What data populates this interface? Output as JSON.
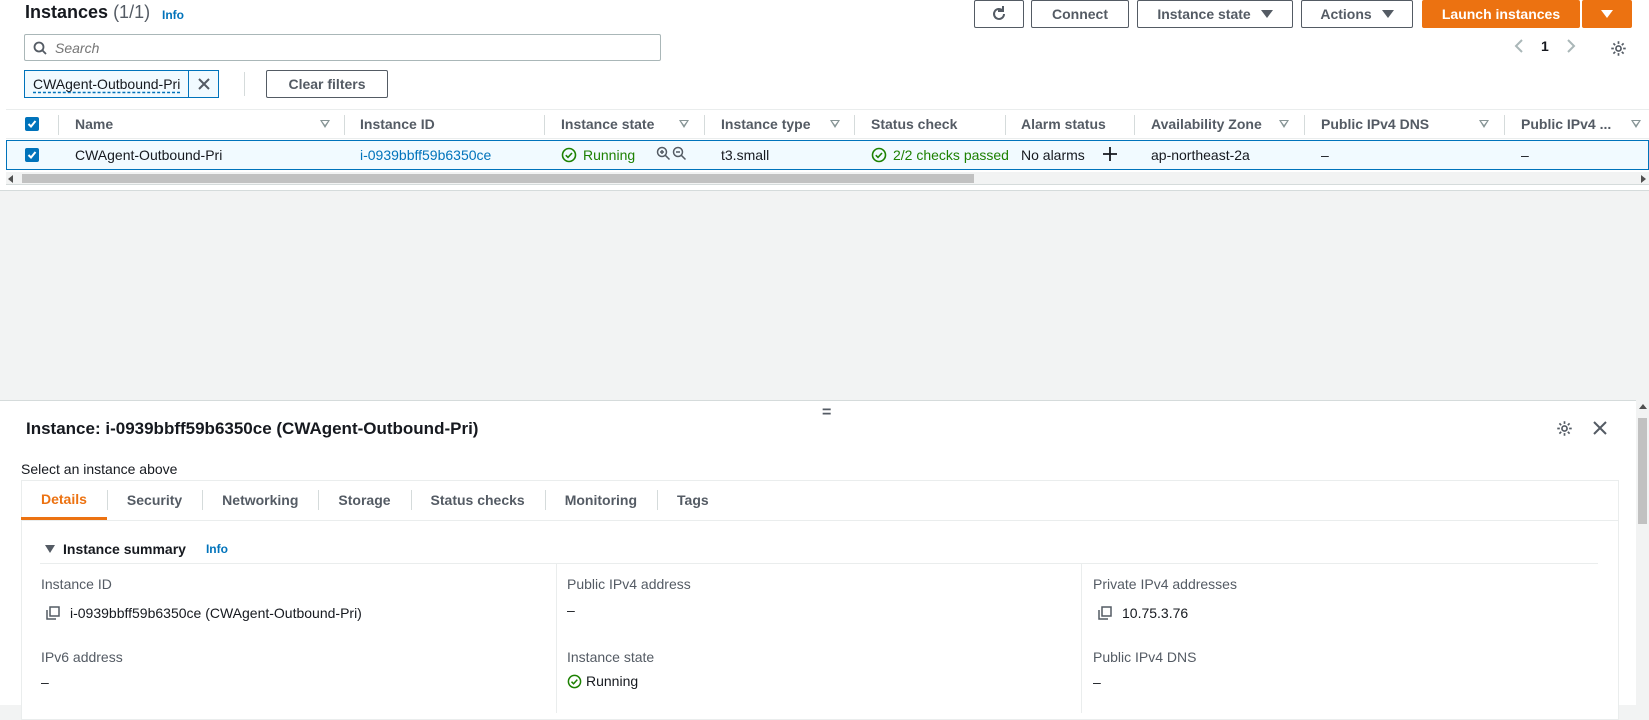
{
  "header": {
    "title": "Instances",
    "count": "(1/1)",
    "info": "Info"
  },
  "toolbar": {
    "connect": "Connect",
    "instance_state": "Instance state",
    "actions": "Actions",
    "launch": "Launch instances"
  },
  "search": {
    "placeholder": "Search"
  },
  "pagination": {
    "page": "1"
  },
  "filter": {
    "chip": "CWAgent-Outbound-Pri",
    "clear": "Clear filters"
  },
  "table": {
    "columns": [
      "Name",
      "Instance ID",
      "Instance state",
      "Instance type",
      "Status check",
      "Alarm status",
      "Availability Zone",
      "Public IPv4 DNS",
      "Public IPv4 ..."
    ],
    "row": {
      "name": "CWAgent-Outbound-Pri",
      "instance_id": "i-0939bbff59b6350ce",
      "state": "Running",
      "type": "t3.small",
      "status_check": "2/2 checks passed",
      "alarm": "No alarms",
      "az": "ap-northeast-2a",
      "public_dns": "–",
      "public_ipv4": "–"
    }
  },
  "detail": {
    "title": "Instance: i-0939bbff59b6350ce (CWAgent-Outbound-Pri)",
    "hint": "Select an instance above",
    "tabs": [
      "Details",
      "Security",
      "Networking",
      "Storage",
      "Status checks",
      "Monitoring",
      "Tags"
    ],
    "active_tab": "Details",
    "summary_title": "Instance summary",
    "summary_info": "Info",
    "fields": {
      "instance_id_label": "Instance ID",
      "instance_id_value": "i-0939bbff59b6350ce (CWAgent-Outbound-Pri)",
      "public_ipv4_label": "Public IPv4 address",
      "public_ipv4_value": "–",
      "private_ipv4_label": "Private IPv4 addresses",
      "private_ipv4_value": "10.75.3.76",
      "ipv6_label": "IPv6 address",
      "ipv6_value": "–",
      "state_label": "Instance state",
      "state_value": "Running",
      "public_dns_label": "Public IPv4 DNS",
      "public_dns_value": "–"
    }
  },
  "colors": {
    "accent": "#ec7211",
    "link": "#0073bb",
    "success": "#1d8102"
  }
}
